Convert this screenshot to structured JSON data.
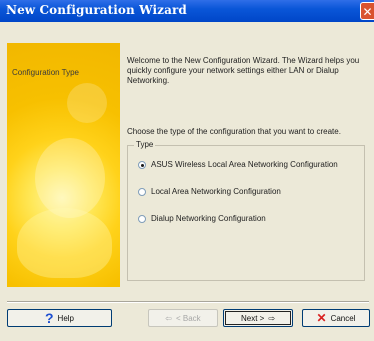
{
  "window": {
    "title": "New Configuration Wizard",
    "close_glyph": "✕"
  },
  "left_panel": {
    "label": "Configuration Type"
  },
  "content": {
    "welcome": "Welcome to the New Configuration Wizard. The Wizard helps you quickly configure your network settings either LAN or Dialup Networking.",
    "choose": "Choose the type of the configuration that you want to create."
  },
  "type_group": {
    "legend": "Type",
    "options": [
      {
        "label": "ASUS Wireless Local Area Networking Configuration",
        "selected": true
      },
      {
        "label": "Local Area Networking Configuration",
        "selected": false
      },
      {
        "label": "Dialup Networking Configuration",
        "selected": false
      }
    ]
  },
  "buttons": {
    "help": "Help",
    "back": "< Back",
    "next": "Next >",
    "cancel": "Cancel"
  },
  "icons": {
    "help": "question-mark-icon",
    "back": "arrow-left-icon",
    "next": "arrow-right-icon",
    "cancel": "red-x-icon"
  },
  "colors": {
    "title_bar": "#0a56d8",
    "panel_yellow": "#f7c000",
    "window_bg": "#ECE9D8"
  }
}
